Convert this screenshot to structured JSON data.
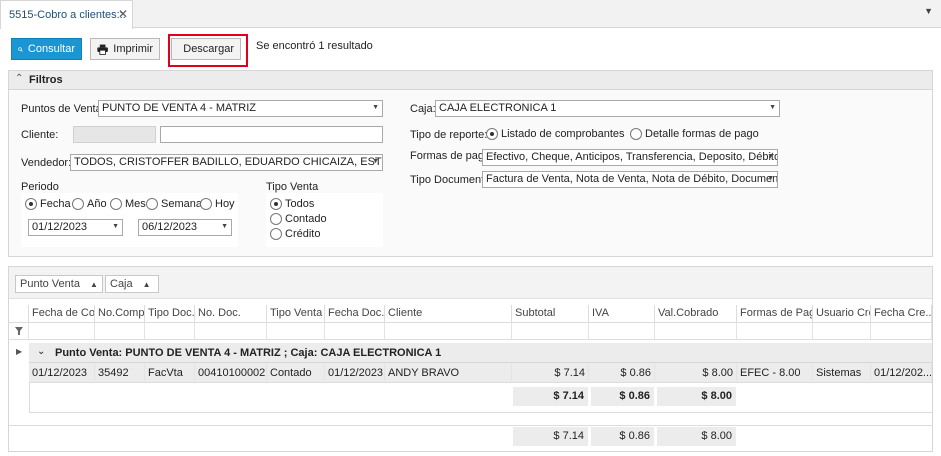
{
  "tab": {
    "title": "5515-Cobro a clientes::.",
    "close": "✕",
    "menu": "▼"
  },
  "toolbar": {
    "consultar": "Consultar",
    "imprimir": "Imprimir",
    "descargar": "Descargar",
    "status": "Se encontró 1 resultado"
  },
  "filters": {
    "title": "Filtros",
    "puntos_label": "Puntos de Venta:",
    "puntos_value": "PUNTO DE VENTA 4 - MATRIZ",
    "cliente_label": "Cliente:",
    "cliente_code": "",
    "cliente_name": "",
    "vendedor_label": "Vendedor:",
    "vendedor_value": "TODOS, CRISTOFFER BADILLO, EDUARDO CHICAIZA, ESTEBAN SAN ...",
    "caja_label": "Caja:",
    "caja_value": "CAJA ELECTRONICA 1",
    "tipo_reporte_label": "Tipo de reporte:",
    "tipo_reporte_opt1": "Listado de comprobantes",
    "tipo_reporte_opt2": "Detalle formas de pago",
    "formas_pago_label": "Formas de pago",
    "formas_pago_value": "Efectivo, Cheque, Anticipos, Transferencia, Deposito, Débito Ban...",
    "tipo_doc_label": "Tipo Documento",
    "tipo_doc_value": "Factura de Venta, Nota de Venta, Nota de Débito, Documento de...",
    "periodo_label": "Periodo",
    "periodo_opts": [
      "Fecha",
      "Año",
      "Mes",
      "Semana",
      "Hoy"
    ],
    "fecha_desde": "01/12/2023",
    "fecha_hasta": "06/12/2023",
    "tipo_venta_label": "Tipo Venta",
    "tipo_venta_opts": [
      "Todos",
      "Contado",
      "Crédito"
    ]
  },
  "grid": {
    "group_chips": [
      "Punto Venta",
      "Caja"
    ],
    "columns": [
      "Fecha de Co...",
      "No.Comp...",
      "Tipo Doc.",
      "No. Doc.",
      "Tipo Venta",
      "Fecha Doc.",
      "Cliente",
      "Subtotal",
      "IVA",
      "Val.Cobrado",
      "Formas de Pago",
      "Usuario Cre...",
      "Fecha Cre..."
    ],
    "group_row": "Punto Venta: PUNTO DE VENTA 4 - MATRIZ ; Caja: CAJA ELECTRONICA 1",
    "rows": [
      [
        "01/12/2023",
        "35492",
        "FacVta",
        "00410100002...",
        "Contado",
        "01/12/2023",
        "ANDY BRAVO",
        "$ 7.14",
        "$ 0.86",
        "$ 8.00",
        "EFEC - 8.00",
        "Sistemas",
        "01/12/202..."
      ]
    ],
    "group_summary": {
      "subtotal": "$ 7.14",
      "iva": "$ 0.86",
      "cobrado": "$ 8.00"
    },
    "total_summary": {
      "subtotal": "$ 7.14",
      "iva": "$ 0.86",
      "cobrado": "$ 8.00"
    }
  }
}
